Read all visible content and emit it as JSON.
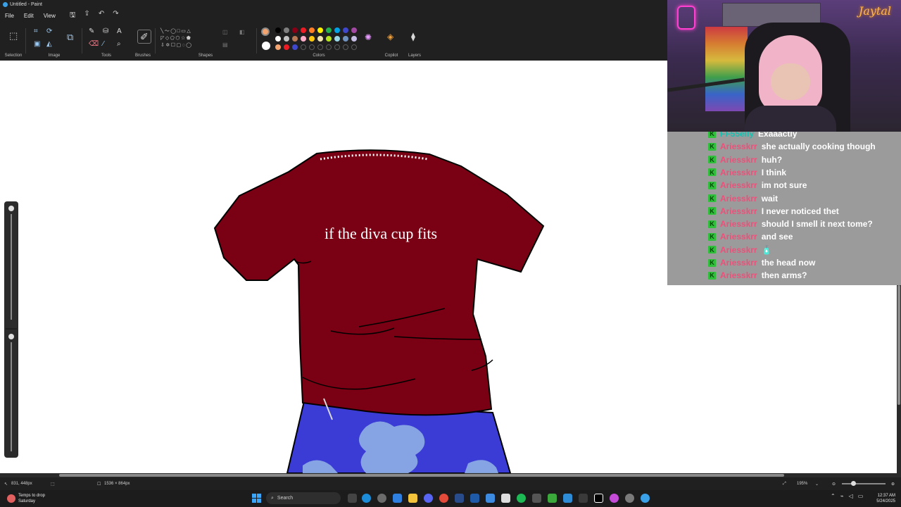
{
  "window": {
    "title": "Untitled - Paint"
  },
  "menu": {
    "file": "File",
    "edit": "Edit",
    "view": "View"
  },
  "ribbon": {
    "groups": {
      "selection": "Selection",
      "image": "Image",
      "tools": "Tools",
      "brushes": "Brushes",
      "shapes": "Shapes",
      "colors": "Colors",
      "copilot": "Copilot",
      "layers": "Layers"
    },
    "primary_color": "#f4a46e",
    "secondary_color": "#ffffff",
    "palette_row1": [
      "#000000",
      "#7f7f7f",
      "#880015",
      "#ed1c24",
      "#ff7f27",
      "#fff200",
      "#22b14c",
      "#00a2e8",
      "#3f48cc",
      "#a349a4"
    ],
    "palette_row2": [
      "#ffffff",
      "#c3c3c3",
      "#b97a57",
      "#ffaec9",
      "#ffc90e",
      "#efe4b0",
      "#b5e61d",
      "#99d9ea",
      "#7092be",
      "#c8bfe7"
    ],
    "palette_row3": [
      "#f4a46e",
      "#ed1c24",
      "#3f48cc"
    ]
  },
  "canvas": {
    "shirt_text": "if the diva cup fits",
    "shirt_color": "#7a0013",
    "pants_color": "#3b3bd6"
  },
  "webcam": {
    "signature": "Jaytal"
  },
  "chat": {
    "messages": [
      {
        "user": "FF55elly",
        "text": "Exaaactly",
        "user_color": "teal"
      },
      {
        "user": "Ariesskrr",
        "text": "she actually cooking though"
      },
      {
        "user": "Ariesskrr",
        "text": "huh?"
      },
      {
        "user": "Ariesskrr",
        "text": "I think"
      },
      {
        "user": "Ariesskrr",
        "text": "im not sure"
      },
      {
        "user": "Ariesskrr",
        "text": "wait"
      },
      {
        "user": "Ariesskrr",
        "text": "I never noticed thet"
      },
      {
        "user": "Ariesskrr",
        "text": "should I smell it next tome?"
      },
      {
        "user": "Ariesskrr",
        "text": "and see"
      },
      {
        "user": "Ariesskrr",
        "text": "🧴"
      },
      {
        "user": "Ariesskrr",
        "text": "the head now"
      },
      {
        "user": "Ariesskrr",
        "text": "then arms?"
      }
    ]
  },
  "status": {
    "cursor_pos": "831, 448px",
    "canvas_size": "1536 × 864px",
    "zoom": "195%"
  },
  "taskbar": {
    "weather_line1": "Temps to drop",
    "weather_line2": "Saturday",
    "search_placeholder": "Search",
    "time": "12:37 AM",
    "date": "5/24/2025"
  }
}
